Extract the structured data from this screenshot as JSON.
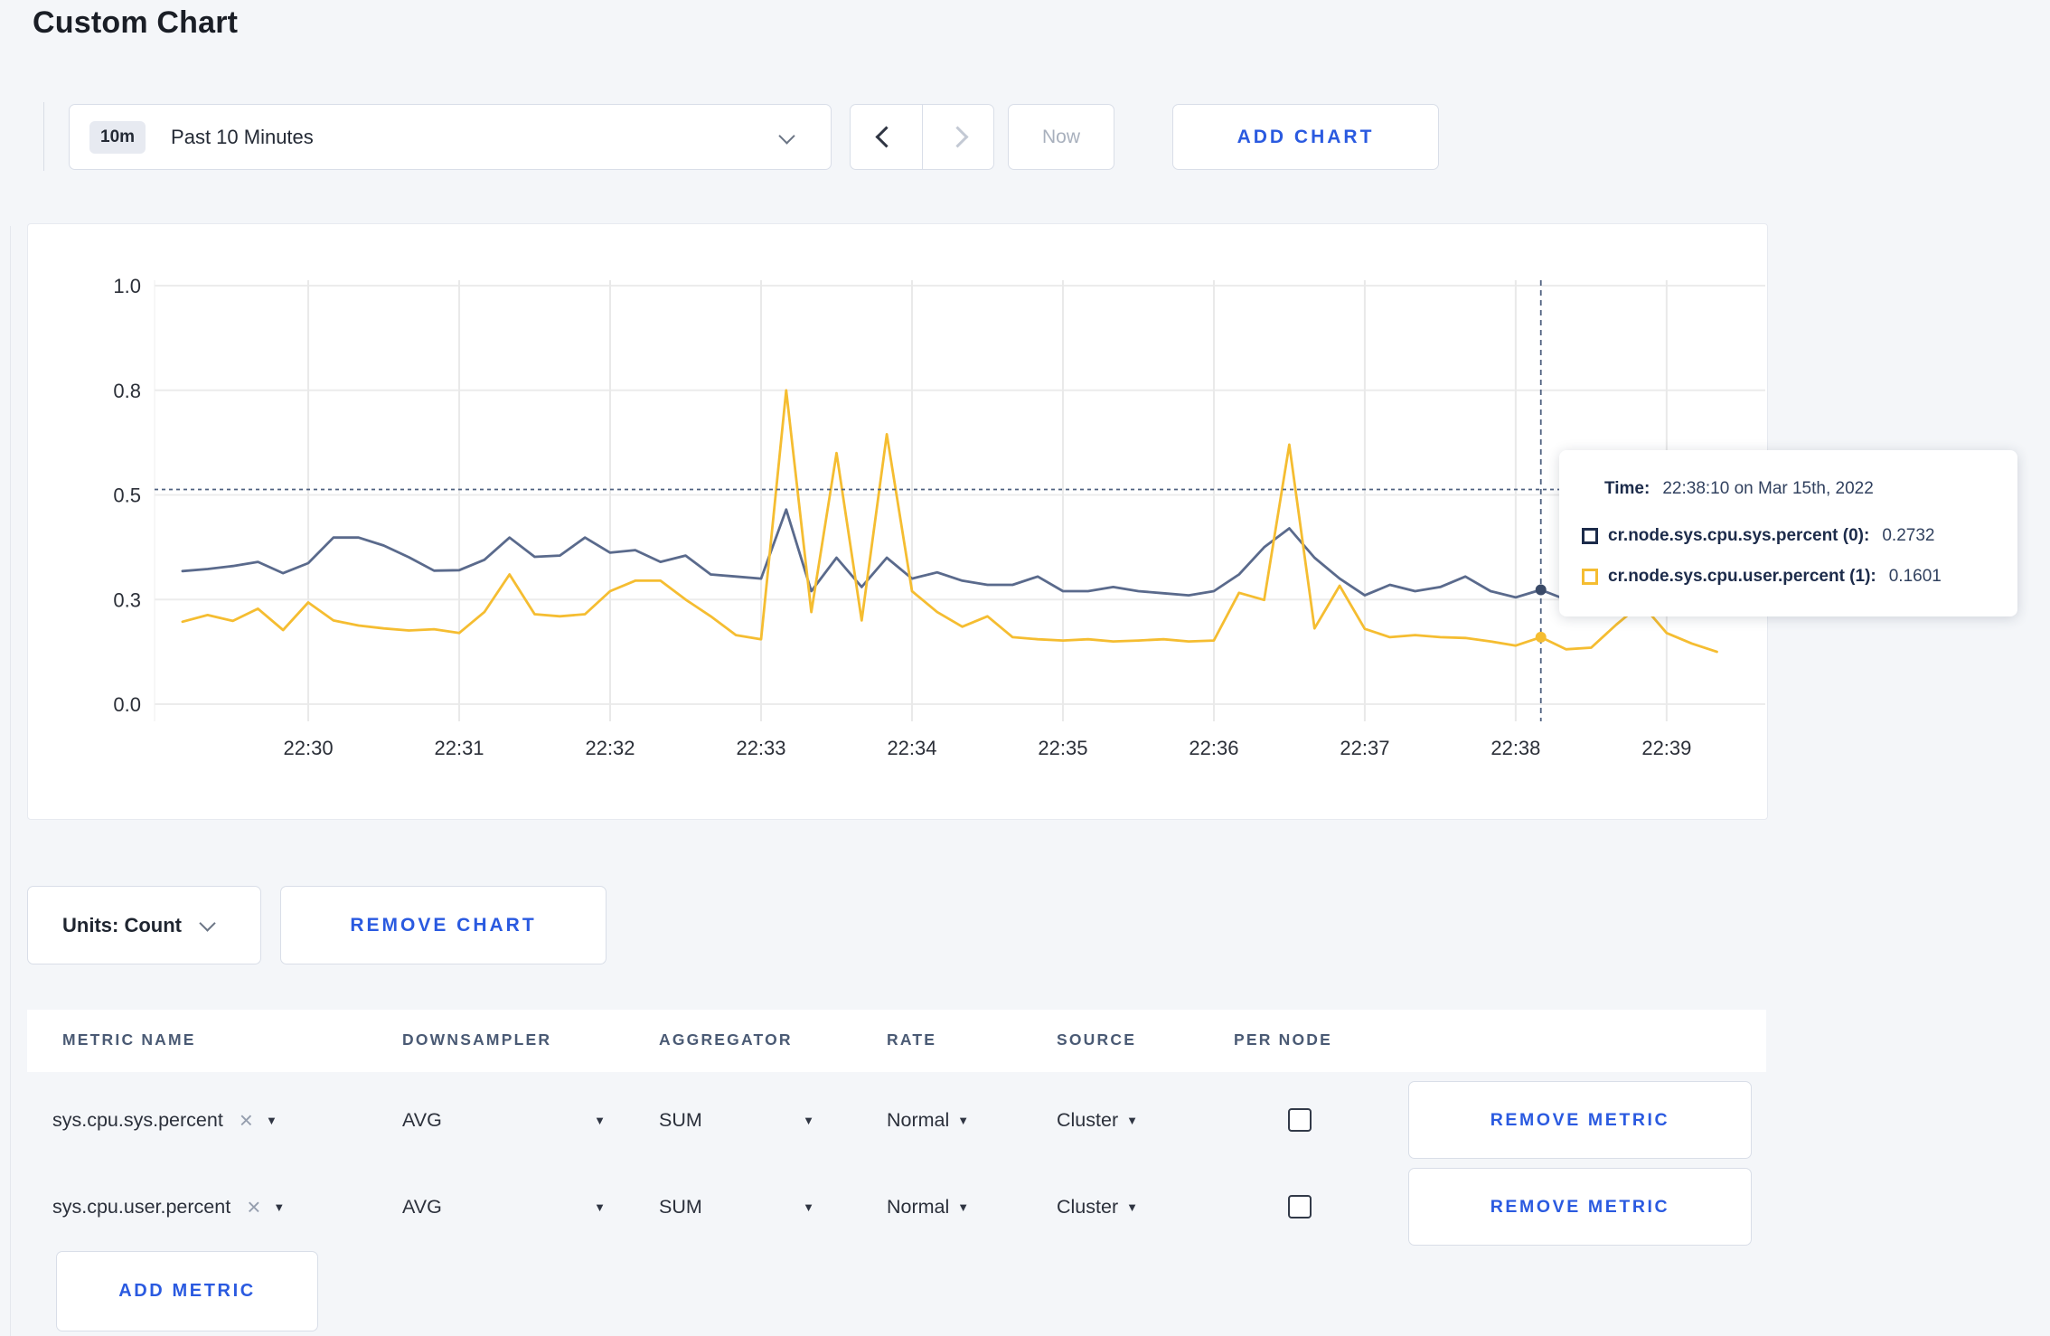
{
  "page": {
    "title": "Custom Chart"
  },
  "toolbar": {
    "time_badge": "10m",
    "time_label": "Past 10 Minutes",
    "prev_icon": "chevron-left",
    "next_icon": "chevron-right",
    "now_label": "Now",
    "add_chart_label": "ADD CHART"
  },
  "chart_controls": {
    "units_label": "Units: Count",
    "remove_chart_label": "REMOVE CHART"
  },
  "tooltip": {
    "time_label": "Time:",
    "time_value": "22:38:10 on Mar 15th, 2022",
    "series": [
      {
        "name": "cr.node.sys.cpu.sys.percent (0):",
        "value": "0.2732",
        "swatch": "#1c2b4a"
      },
      {
        "name": "cr.node.sys.cpu.user.percent (1):",
        "value": "0.1601",
        "swatch": "#f5bd31"
      }
    ]
  },
  "chart_data": {
    "type": "line",
    "title": "",
    "xlabel": "",
    "ylabel": "",
    "ylim": [
      0,
      1
    ],
    "grid": true,
    "legend_position": "none",
    "x_start": "22:29:10",
    "x_step_seconds": 10,
    "x_tick_labels": [
      "22:30",
      "22:31",
      "22:32",
      "22:33",
      "22:34",
      "22:35",
      "22:36",
      "22:37",
      "22:38",
      "22:39"
    ],
    "y_tick_labels": [
      "0.0",
      "0.3",
      "0.5",
      "0.8",
      "1.0"
    ],
    "y_tick_values": [
      0,
      0.25,
      0.5,
      0.75,
      1.0
    ],
    "crosshair": {
      "time": "22:38:10",
      "x_index": 54,
      "y_value": 0.513
    },
    "series": [
      {
        "name": "cr.node.sys.cpu.sys.percent",
        "color": "#5a6a8c",
        "dot_color": "#3a4a68",
        "values": [
          0.318,
          0.323,
          0.33,
          0.34,
          0.313,
          0.337,
          0.398,
          0.398,
          0.379,
          0.351,
          0.319,
          0.32,
          0.345,
          0.398,
          0.352,
          0.355,
          0.398,
          0.362,
          0.368,
          0.34,
          0.355,
          0.31,
          0.305,
          0.3,
          0.465,
          0.27,
          0.35,
          0.28,
          0.35,
          0.3,
          0.315,
          0.295,
          0.285,
          0.285,
          0.305,
          0.27,
          0.27,
          0.28,
          0.27,
          0.265,
          0.26,
          0.27,
          0.31,
          0.375,
          0.42,
          0.35,
          0.3,
          0.26,
          0.285,
          0.27,
          0.28,
          0.305,
          0.27,
          0.255,
          0.2732,
          0.25,
          0.26,
          0.27,
          0.285,
          0.3,
          0.31,
          0.3
        ]
      },
      {
        "name": "cr.node.sys.cpu.user.percent",
        "color": "#f5bd31",
        "dot_color": "#f5bd31",
        "values": [
          0.197,
          0.213,
          0.199,
          0.228,
          0.177,
          0.243,
          0.2,
          0.188,
          0.181,
          0.176,
          0.179,
          0.17,
          0.22,
          0.31,
          0.215,
          0.21,
          0.215,
          0.27,
          0.295,
          0.295,
          0.25,
          0.21,
          0.165,
          0.155,
          0.75,
          0.22,
          0.6,
          0.2,
          0.645,
          0.27,
          0.22,
          0.185,
          0.21,
          0.16,
          0.155,
          0.152,
          0.155,
          0.15,
          0.152,
          0.155,
          0.15,
          0.152,
          0.266,
          0.249,
          0.62,
          0.181,
          0.283,
          0.18,
          0.16,
          0.165,
          0.16,
          0.158,
          0.15,
          0.14,
          0.1601,
          0.131,
          0.135,
          0.19,
          0.24,
          0.17,
          0.145,
          0.125
        ]
      }
    ]
  },
  "metrics_table": {
    "headers": [
      "METRIC NAME",
      "DOWNSAMPLER",
      "AGGREGATOR",
      "RATE",
      "SOURCE",
      "PER NODE"
    ],
    "rows": [
      {
        "name": "sys.cpu.sys.percent",
        "downsampler": "AVG",
        "aggregator": "SUM",
        "rate": "Normal",
        "source": "Cluster",
        "per_node_checked": false,
        "remove_label": "REMOVE METRIC"
      },
      {
        "name": "sys.cpu.user.percent",
        "downsampler": "AVG",
        "aggregator": "SUM",
        "rate": "Normal",
        "source": "Cluster",
        "per_node_checked": false,
        "remove_label": "REMOVE METRIC"
      }
    ],
    "add_metric_label": "ADD METRIC"
  },
  "colors": {
    "accent_blue": "#2a5ae0",
    "page_background": "#f4f6f9",
    "series_sys": "#5a6a8c",
    "series_user": "#f5bd31",
    "gridline": "#ececec",
    "crosshair": "#4f6180"
  }
}
